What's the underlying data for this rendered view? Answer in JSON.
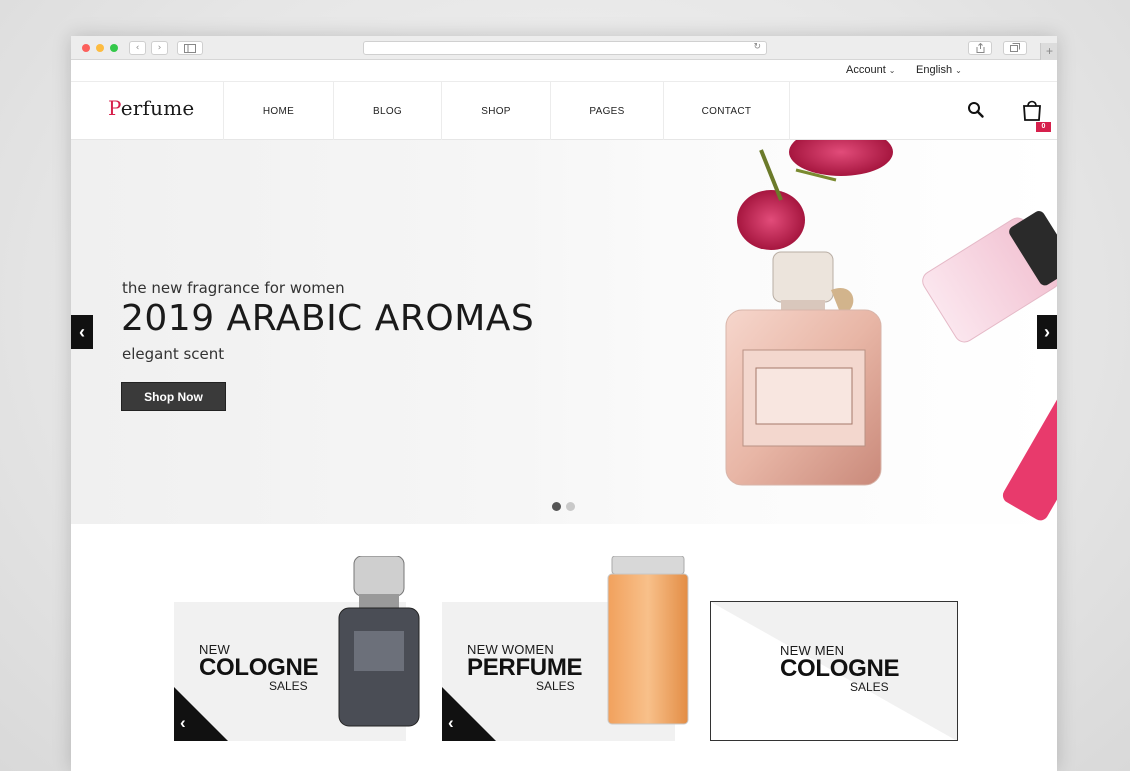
{
  "browser": {
    "nav_back": "‹",
    "nav_forward": "›",
    "reload": "↻",
    "new_tab": "+"
  },
  "topbar": {
    "account": "Account",
    "language": "English"
  },
  "site": {
    "logo_first": "P",
    "logo_rest": "erfume",
    "brand_color": "#d6204c"
  },
  "nav": {
    "items": [
      "HOME",
      "BLOG",
      "SHOP",
      "PAGES",
      "CONTACT"
    ]
  },
  "cart": {
    "count": "0"
  },
  "hero": {
    "subtitle": "the new fragrance for women",
    "title": "2019 ARABIC AROMAS",
    "tagline": "elegant scent",
    "button": "Shop Now",
    "prev": "‹",
    "next": "›",
    "slides": 2,
    "active_slide": 1
  },
  "banners": [
    {
      "line1": "NEW",
      "line2": "COLOGNE",
      "line3": "SALES",
      "arrow": "‹"
    },
    {
      "line1": "NEW WOMEN",
      "line2": "PERFUME",
      "line3": "SALES",
      "arrow": "‹"
    },
    {
      "line1": "NEW MEN",
      "line2": "COLOGNE",
      "line3": "SALES"
    }
  ]
}
